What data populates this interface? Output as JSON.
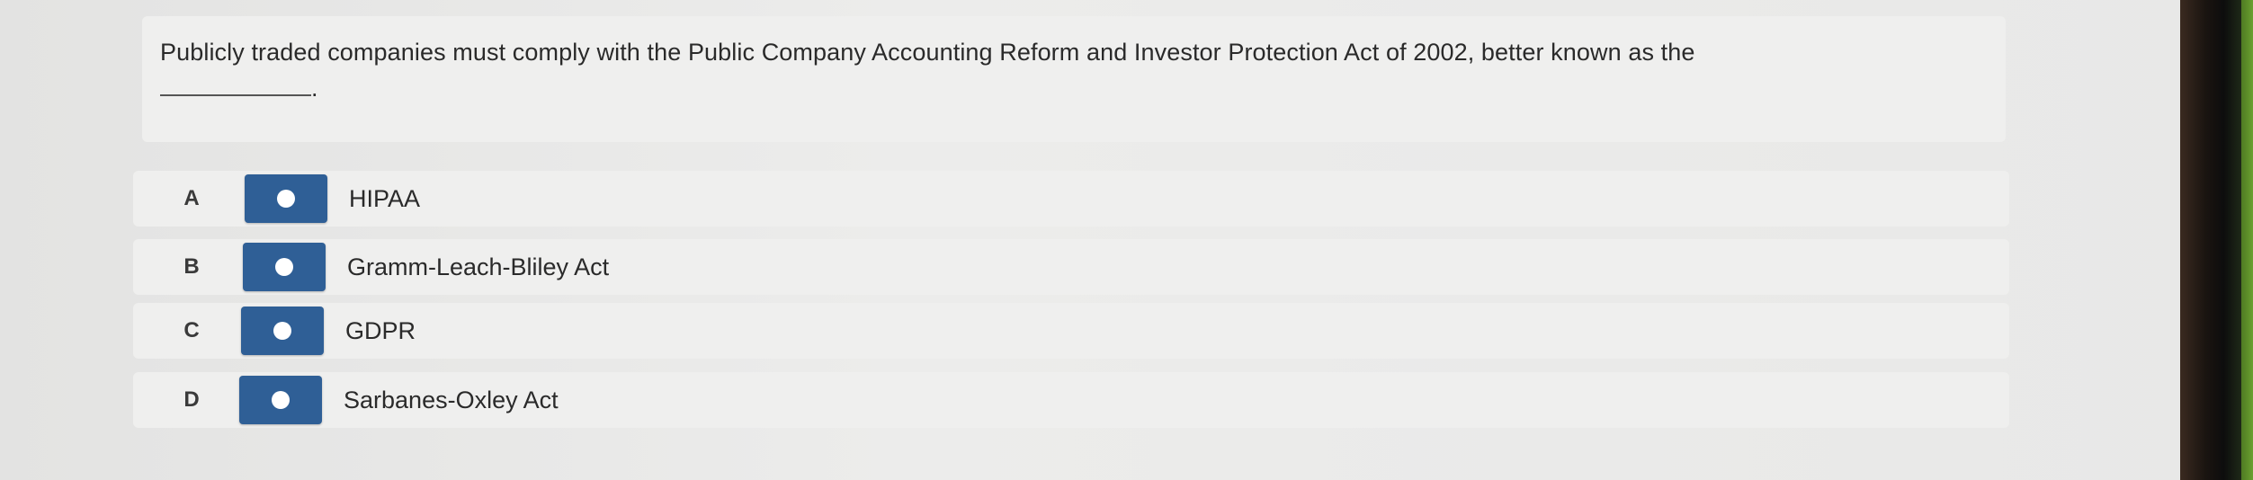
{
  "question": {
    "text": "Publicly traded companies must comply with the Public Company Accounting Reform and Investor Protection Act of 2002, better known as the",
    "trailing": "."
  },
  "options": [
    {
      "letter": "A",
      "label": "HIPAA"
    },
    {
      "letter": "B",
      "label": "Gramm-Leach-Bliley Act"
    },
    {
      "letter": "C",
      "label": "GDPR"
    },
    {
      "letter": "D",
      "label": "Sarbanes-Oxley Act"
    }
  ],
  "colors": {
    "radio_button": "#2f5f96",
    "radio_dot": "#ffffff",
    "card_background": "#efefee"
  }
}
